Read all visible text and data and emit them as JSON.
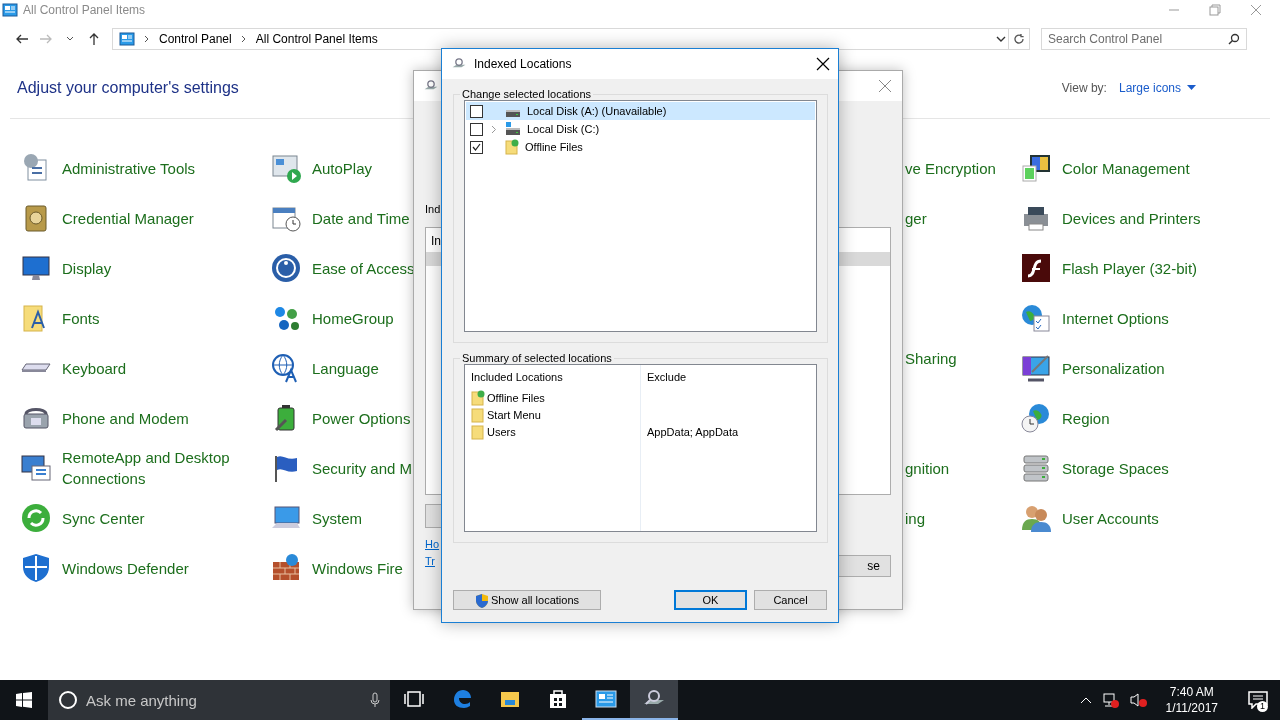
{
  "window": {
    "title": "All Control Panel Items"
  },
  "address_bar": {
    "path": [
      "Control Panel",
      "All Control Panel Items"
    ]
  },
  "search": {
    "placeholder": "Search Control Panel"
  },
  "header": {
    "title": "Adjust your computer's settings",
    "view_by_label": "View by:",
    "view_by_value": "Large icons"
  },
  "rows": [
    [
      {
        "kind": "item",
        "label": "Administrative Tools"
      },
      {
        "kind": "item",
        "label": "AutoPlay"
      },
      {
        "kind": "partial",
        "label": "ve Encryption"
      },
      {
        "kind": "item",
        "label": "Color Management"
      }
    ],
    [
      {
        "kind": "item",
        "label": "Credential Manager"
      },
      {
        "kind": "item",
        "label": "Date and Time"
      },
      {
        "kind": "partial",
        "label": "ger"
      },
      {
        "kind": "item",
        "label": "Devices and Printers"
      }
    ],
    [
      {
        "kind": "item",
        "label": "Display"
      },
      {
        "kind": "item",
        "label": "Ease of Access"
      },
      {
        "kind": "empty"
      },
      {
        "kind": "item",
        "label": "Flash Player (32-bit)"
      }
    ],
    [
      {
        "kind": "item",
        "label": "Fonts"
      },
      {
        "kind": "item",
        "label": "HomeGroup"
      },
      {
        "kind": "empty"
      },
      {
        "kind": "item",
        "label": "Internet Options"
      }
    ],
    [
      {
        "kind": "item",
        "label": "Keyboard"
      },
      {
        "kind": "item",
        "label": "Language"
      },
      {
        "kind": "partial",
        "label": "Sharing"
      },
      {
        "kind": "item",
        "label": "Personalization"
      }
    ],
    [
      {
        "kind": "item",
        "label": "Phone and Modem"
      },
      {
        "kind": "item",
        "label": "Power Options"
      },
      {
        "kind": "empty"
      },
      {
        "kind": "item",
        "label": "Region"
      }
    ],
    [
      {
        "kind": "item",
        "label": "RemoteApp and Desktop Connections"
      },
      {
        "kind": "item",
        "label": "Security and M"
      },
      {
        "kind": "partial",
        "label": "gnition"
      },
      {
        "kind": "item",
        "label": "Storage Spaces"
      }
    ],
    [
      {
        "kind": "item",
        "label": "Sync Center"
      },
      {
        "kind": "item",
        "label": "System"
      },
      {
        "kind": "partial",
        "label": "ing"
      },
      {
        "kind": "item",
        "label": "User Accounts"
      }
    ],
    [
      {
        "kind": "item",
        "label": "Windows Defender"
      },
      {
        "kind": "item",
        "label": "Windows Fire"
      },
      {
        "kind": "empty"
      },
      {
        "kind": "empty"
      }
    ]
  ],
  "background_dialog": {
    "label": "Ind",
    "list_header": "In",
    "links": [
      "Ho",
      "Tr"
    ],
    "button": "se"
  },
  "dialog": {
    "title": "Indexed Locations",
    "change_group": {
      "legend": "Change selected locations",
      "items": [
        {
          "label": "Local Disk (A:) (Unavailable)",
          "kind": "drive",
          "checked": false,
          "selected": true,
          "has_children": false
        },
        {
          "label": "Local Disk (C:)",
          "kind": "system-drive",
          "checked": false,
          "selected": false,
          "has_children": true
        },
        {
          "label": "Offline Files",
          "kind": "offline",
          "checked": true,
          "selected": false,
          "has_children": false
        }
      ]
    },
    "summary_group": {
      "legend": "Summary of selected locations",
      "columns": [
        "Included Locations",
        "Exclude"
      ],
      "rows": [
        {
          "kind": "offline",
          "location": "Offline Files"
        },
        {
          "kind": "folder",
          "location": "Start Menu"
        },
        {
          "kind": "folder",
          "location": "Users",
          "exclude": "AppData; AppData"
        }
      ]
    },
    "buttons": [
      {
        "kind": "shield",
        "label": "Show all locations",
        "default": false
      },
      {
        "kind": "plain",
        "label": "OK",
        "default": true
      },
      {
        "kind": "plain",
        "label": "Cancel",
        "default": false
      }
    ]
  },
  "taskbar": {
    "search_placeholder": "Ask me anything",
    "apps": [
      {
        "running": false,
        "focused": false
      },
      {
        "running": false,
        "focused": false
      },
      {
        "running": false,
        "focused": false
      },
      {
        "running": false,
        "focused": false
      },
      {
        "running": true,
        "focused": false
      },
      {
        "running": true,
        "focused": true
      }
    ],
    "time": "7:40 AM",
    "date": "1/11/2017",
    "notification_count": "1"
  }
}
